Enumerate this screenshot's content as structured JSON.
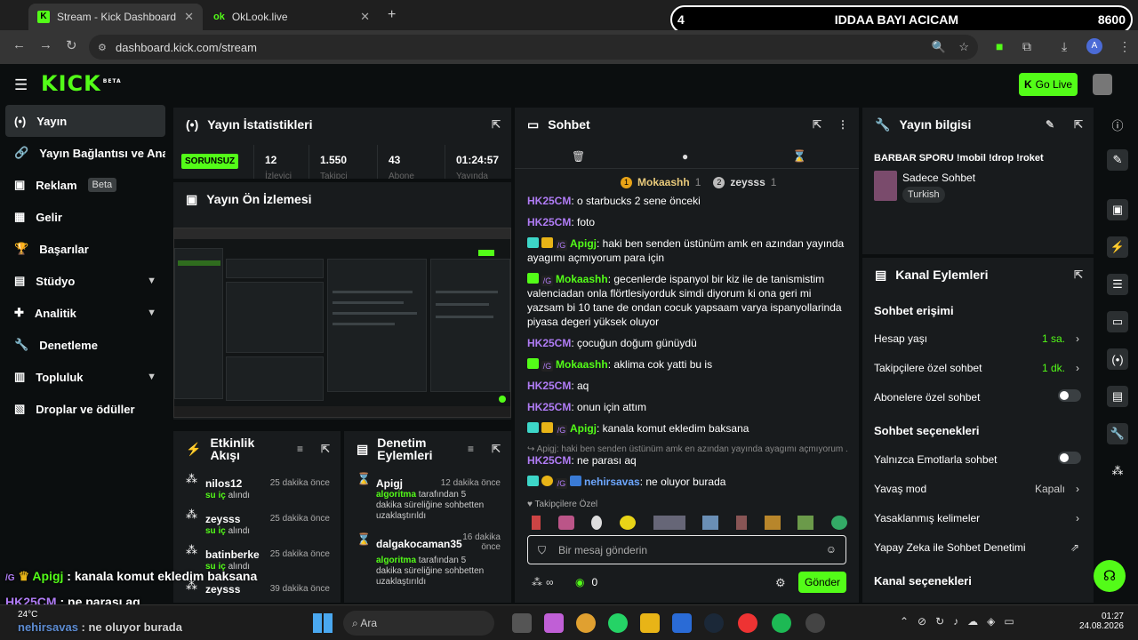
{
  "browser": {
    "tabs": [
      {
        "title": "Stream - Kick Dashboard",
        "active": true
      },
      {
        "title": "OkLook.live",
        "active": false
      }
    ],
    "url": "dashboard.kick.com/stream",
    "profile_initial": "A"
  },
  "overlay": {
    "left_num": "4",
    "title": "IDDAA BAYI ACICAM",
    "right_num": "8600"
  },
  "header": {
    "logo": "KICK",
    "logo_beta": "BETA",
    "go_live": "Go Live"
  },
  "sidebar": {
    "items": [
      {
        "label": "Yayın",
        "icon": "(•)",
        "active": true
      },
      {
        "label": "Yayın Bağlantısı ve Anahtarı",
        "icon": "🔗"
      },
      {
        "label": "Reklam",
        "icon": "▣",
        "badge": "Beta"
      },
      {
        "label": "Gelir",
        "icon": "▦"
      },
      {
        "label": "Başarılar",
        "icon": "🏆"
      },
      {
        "label": "Stüdyo",
        "icon": "▤",
        "chevron": true
      },
      {
        "label": "Analitik",
        "icon": "✚",
        "chevron": true
      },
      {
        "label": "Denetleme",
        "icon": "🔧"
      },
      {
        "label": "Topluluk",
        "icon": "▥",
        "chevron": true
      },
      {
        "label": "Droplar ve ödüller",
        "icon": "▧"
      }
    ]
  },
  "stats": {
    "title": "Yayın İstatistikleri",
    "status": "SORUNSUZ",
    "values": [
      {
        "value": "12",
        "label": "İzleyici"
      },
      {
        "value": "1.550",
        "label": "Takipçi"
      },
      {
        "value": "43",
        "label": "Abone"
      },
      {
        "value": "01:24:57",
        "label": "Yayında"
      }
    ]
  },
  "preview": {
    "title": "Yayın Ön İzlemesi"
  },
  "activity": {
    "title": "Etkinlik Akışı",
    "items": [
      {
        "name": "nilos12",
        "pre": "su iç",
        "post": " alındı",
        "time": "25 dakika önce"
      },
      {
        "name": "zeysss",
        "pre": "su iç",
        "post": " alındı",
        "time": "25 dakika önce"
      },
      {
        "name": "batinberke",
        "pre": "su iç",
        "post": " alındı",
        "time": "25 dakika önce"
      },
      {
        "name": "zeysss",
        "pre": "",
        "post": "",
        "time": "39 dakika önce"
      }
    ]
  },
  "moderation": {
    "title": "Denetim Eylemleri",
    "items": [
      {
        "name": "Apigj",
        "actor": "algoritma",
        "text": " tarafından 5 dakika süreliğine sohbetten uzaklaştırıldı",
        "time": "12 dakika önce"
      },
      {
        "name": "dalgakocaman35",
        "actor": "algoritma",
        "text": " tarafından 5 dakika süreliğine sohbetten uzaklaştırıldı",
        "time": "16 dakika önce"
      }
    ]
  },
  "chat": {
    "title": "Sohbet",
    "pinned": [
      {
        "rank": "1",
        "name": "Mokaashh",
        "count": "1"
      },
      {
        "rank": "2",
        "name": "zeysss",
        "count": "1"
      }
    ],
    "messages": [
      {
        "user": "HK25CM",
        "color": "purple",
        "text": ": o starbucks 2 sene önceki"
      },
      {
        "user": "HK25CM",
        "color": "purple",
        "text": ": foto"
      },
      {
        "user": "Apigj",
        "color": "green",
        "text": ": haki ben senden üstünüm amk en azından yayında ayagımı açmıyorum para için"
      },
      {
        "user": "Mokaashh",
        "color": "green",
        "text": ": gecenlerde ispanyol bir kiz ile de tanismistim valenciadan onla flörtlesiyorduk simdi diyorum ki ona geri mi yazsam bi 10 tane de ondan cocuk yapsaam varya ispanyollarinda piyasa degeri yüksek oluyor"
      },
      {
        "user": "HK25CM",
        "color": "purple",
        "text": ": çocuğun doğum günüydü"
      },
      {
        "user": "Mokaashh",
        "color": "green",
        "text": ": aklima cok yatti bu is"
      },
      {
        "user": "HK25CM",
        "color": "purple",
        "text": ": aq"
      },
      {
        "user": "HK25CM",
        "color": "purple",
        "text": ": onun için attım"
      },
      {
        "user": "Apigj",
        "color": "green",
        "text": ": kanala komut ekledim baksana"
      },
      {
        "user": "HK25CM",
        "color": "purple",
        "text": ": ne parası aq"
      },
      {
        "user": "nehirsavas",
        "color": "blue",
        "text": ": ne oluyor burada"
      }
    ],
    "reply_context": "↪ Apigj: haki ben senden üstünüm amk en azından yayında ayagımı açmıyorum ...",
    "followers_only": "Takipçilere Özel",
    "input_placeholder": "Bir mesaj gönderin",
    "infinity": "∞",
    "points": "0",
    "send": "Gönder"
  },
  "stream_info": {
    "title": "Yayın bilgisi",
    "stream_title": "BARBAR SPORU !mobil !drop !roket",
    "category": "Sadece Sohbet",
    "language": "Turkish"
  },
  "channel_actions": {
    "title": "Kanal Eylemleri",
    "chat_access": "Sohbet erişimi",
    "account_age": {
      "label": "Hesap yaşı",
      "value": "1 sa."
    },
    "followers_chat": {
      "label": "Takipçilere özel sohbet",
      "value": "1 dk."
    },
    "subs_chat": {
      "label": "Abonelere özel sohbet"
    },
    "chat_options": "Sohbet seçenekleri",
    "emote_only": {
      "label": "Yalnızca Emotlarla sohbet"
    },
    "slow_mode": {
      "label": "Yavaş mod",
      "value": "Kapalı"
    },
    "banned_words": {
      "label": "Yasaklanmış kelimeler"
    },
    "ai_moderation": {
      "label": "Yapay Zeka ile Sohbet Denetimi"
    },
    "channel_options": "Kanal seçenekleri"
  },
  "stream_overlay_chat": [
    {
      "user": "Apigj",
      "text": " : kanala komut ekledim baksana"
    },
    {
      "user": "HK25CM",
      "text": " : ne parası aq"
    },
    {
      "user": "nehirsavas",
      "text": " : ne oluyor burada"
    }
  ],
  "taskbar": {
    "weather": "24°C",
    "search": "Ara",
    "time": "01:27",
    "date": "24.08.2026"
  },
  "colors": {
    "accent": "#53fc18",
    "purple_user": "#b07cf5",
    "blue_user": "#6da7ff"
  }
}
